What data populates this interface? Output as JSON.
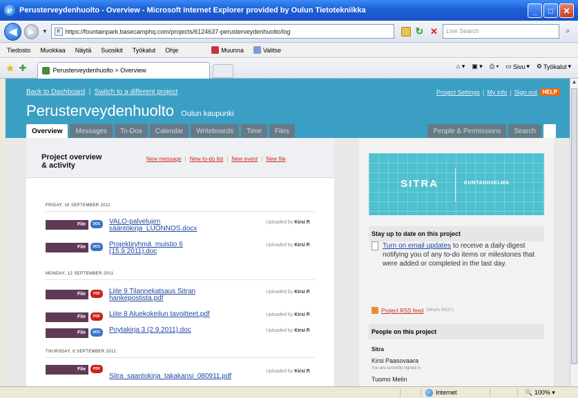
{
  "window": {
    "title": "Perusterveydenhuolto - Overview - Microsoft Internet Explorer provided by Oulun Tietotekniikka",
    "min": "_",
    "max": "□",
    "close": "✕"
  },
  "address": {
    "url": "https://fountainpark.basecamphq.com/projects/6124637-perusterveydenhuolto/log",
    "search_placeholder": "Live Search"
  },
  "menu": {
    "items": [
      "Tiedosto",
      "Muokkaa",
      "Näytä",
      "Suosikit",
      "Työkalut",
      "Ohje"
    ],
    "toolbar": [
      {
        "label": "Muunna",
        "icon": "convert-icon"
      },
      {
        "label": "Valitse",
        "icon": "select-icon"
      }
    ]
  },
  "favbar": {
    "tab_label": "Perusterveydenhuolto > Overview",
    "commands": [
      "Sivu",
      "Työkalut"
    ]
  },
  "basecamp": {
    "back_link": "Back to Dashboard",
    "switch_link": "Switch to a different project",
    "right_links": [
      "Project Settings",
      "My info",
      "Sign out"
    ],
    "help": "HELP",
    "project_title": "Perusterveydenhuolto",
    "project_sub": "Oulun kaupunki",
    "tabs": [
      "Overview",
      "Messages",
      "To-Dos",
      "Calendar",
      "Writeboards",
      "Time",
      "Files"
    ],
    "right_tabs": [
      "People & Permissions",
      "Search"
    ]
  },
  "overview": {
    "title_line1": "Project overview",
    "title_line2": "& activity",
    "links": [
      "New message",
      "New to-do list",
      "New event",
      "New file"
    ],
    "days": [
      {
        "label": "FRIDAY, 16 SEPTEMBER 2011",
        "entries": [
          {
            "badge": "File",
            "type": "DOC",
            "name": "VALO-palvelujen sääntökirja_LUONNOS.docx",
            "uploaded": "Uploaded by",
            "by": "Kirsi P."
          },
          {
            "badge": "File",
            "type": "DOC",
            "name": "Projektiryhmä_muistio 6 (15.9.2011).doc",
            "uploaded": "Uploaded by",
            "by": "Kirsi P."
          }
        ]
      },
      {
        "label": "MONDAY, 12 SEPTEMBER 2011",
        "entries": [
          {
            "badge": "File",
            "type": "PDF",
            "name": "Liite 9 Tilannekatsaus Sitran hankepostista.pdf",
            "uploaded": "Uploaded by",
            "by": "Kirsi P."
          },
          {
            "badge": "File",
            "type": "PDF",
            "name": "Liite 8 Aluekokeilun tavoitteet.pdf",
            "uploaded": "Uploaded by",
            "by": "Kirsi P."
          },
          {
            "badge": "File",
            "type": "DOC",
            "name": "Poytakirja 3 (2.9.2011).doc",
            "uploaded": "Uploaded by",
            "by": "Kirsi P."
          }
        ]
      },
      {
        "label": "THURSDAY, 8 SEPTEMBER 2011",
        "entries": [
          {
            "badge": "File",
            "type": "PDF",
            "name": "Sitra_saantokirja_takakansi_080911.pdf",
            "uploaded": "Uploaded by",
            "by": "Kirsi P."
          }
        ]
      }
    ]
  },
  "sidebar": {
    "banner_logo": "SITRA",
    "banner_text": "KUNTAOHJELMA",
    "stay_heading": "Stay up to date on this project",
    "email_link": "Turn on email updates",
    "email_text": "to receive a daily digest notifying you of any to-do items or milestones that were added or completed in the last day.",
    "rss_link": "Project RSS feed",
    "rss_whats": "(What's RSS?)",
    "people_heading": "People on this project",
    "org": "Sitra",
    "people": [
      {
        "name": "Kirsi Paasovaara",
        "note": "You are currently signed in"
      },
      {
        "name": "Tuomo Melin",
        "note": ""
      }
    ]
  },
  "status": {
    "zone": "Internet",
    "zoom": "100%"
  }
}
